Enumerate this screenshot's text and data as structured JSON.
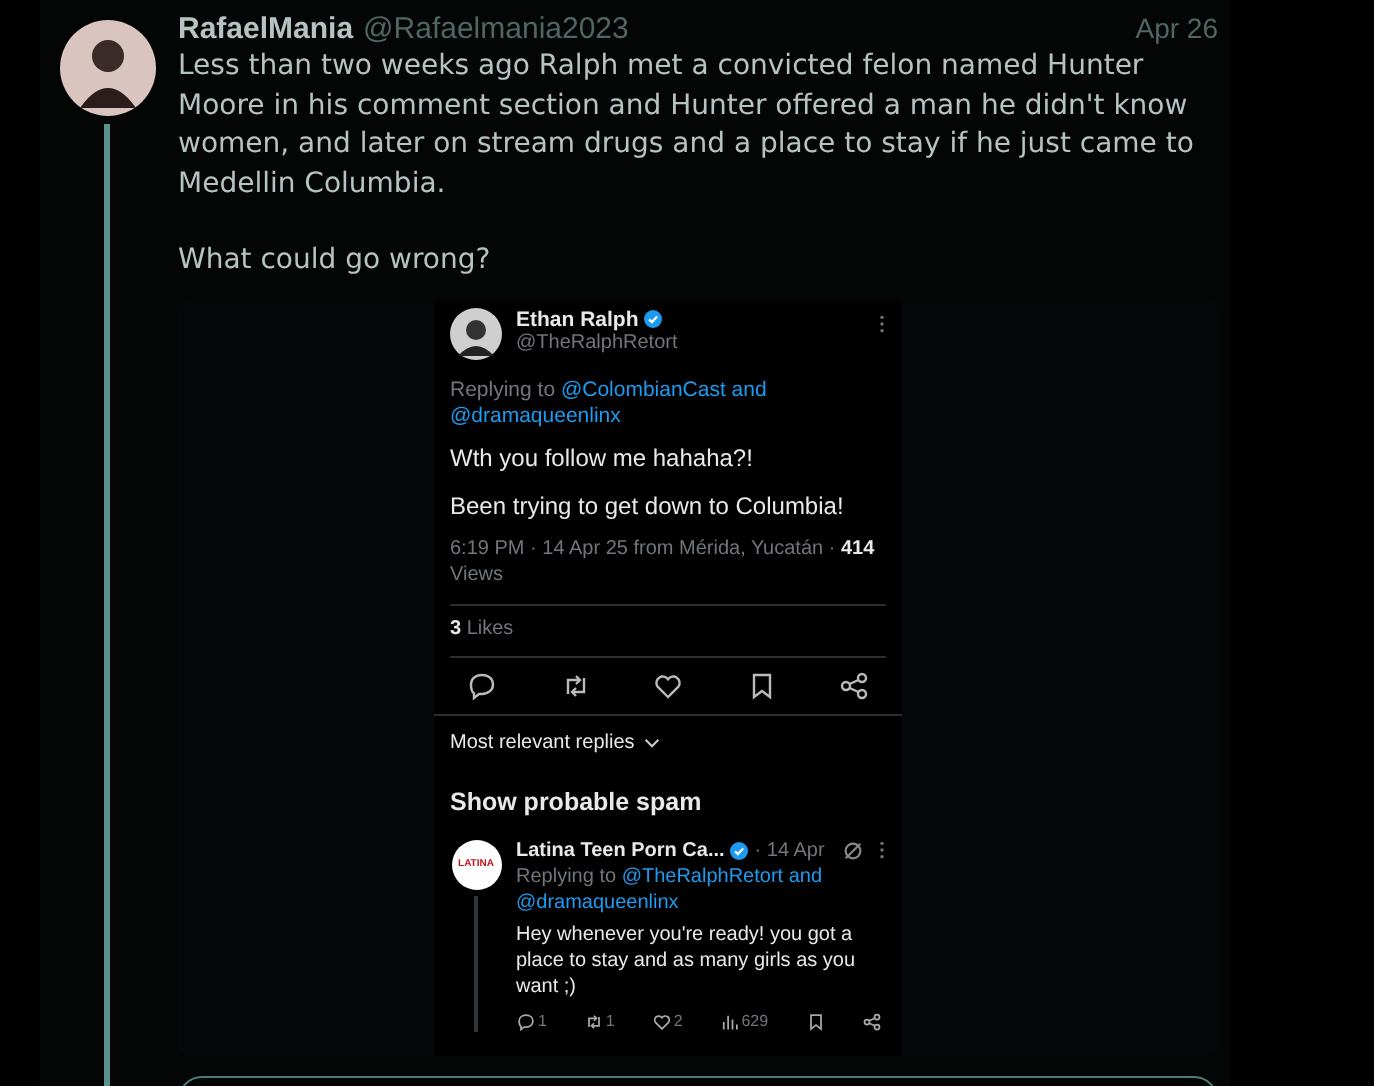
{
  "post": {
    "display_name": "RafaelMania",
    "handle": "@Rafaelmania2023",
    "date": "Apr 26",
    "paragraphs": [
      "Less than two weeks ago Ralph met a convicted felon named Hunter Moore in his comment section and Hunter offered a man he didn't know women, and later on stream drugs and a place to stay if he just came to Medellin Columbia.",
      "What could go wrong?"
    ]
  },
  "embedded": {
    "author": {
      "name": "Ethan Ralph",
      "handle": "@TheRalphRetort",
      "verified": true
    },
    "replying_prefix": "Replying to",
    "replying_to": "@ColombianCast and @dramaqueenlinx",
    "paragraphs": [
      "Wth you follow me hahaha?!",
      "Been trying to get down to Columbia!"
    ],
    "meta": "6:19 PM · 14 Apr 25 from Mérida, Yucatán · ",
    "views_count": "414",
    "views_label": "Views",
    "likes_count": "3",
    "likes_label": "Likes",
    "sort_label": "Most relevant replies",
    "spam_label": "Show probable spam",
    "reply": {
      "name": "Latina Teen Porn Ca...",
      "verified": true,
      "date": "· 14 Apr",
      "logo_text": "LATINA",
      "replying_prefix": "Replying to",
      "replying_to": "@TheRalphRetort and @dramaqueenlinx",
      "text": "Hey whenever you're ready! you got a place to stay and as many girls as you want ;)",
      "stats": [
        {
          "kind": "reply",
          "count": "1"
        },
        {
          "kind": "repost",
          "count": "1"
        },
        {
          "kind": "like",
          "count": "2"
        },
        {
          "kind": "views",
          "count": "629"
        },
        {
          "kind": "bookmark"
        },
        {
          "kind": "share"
        }
      ]
    }
  }
}
